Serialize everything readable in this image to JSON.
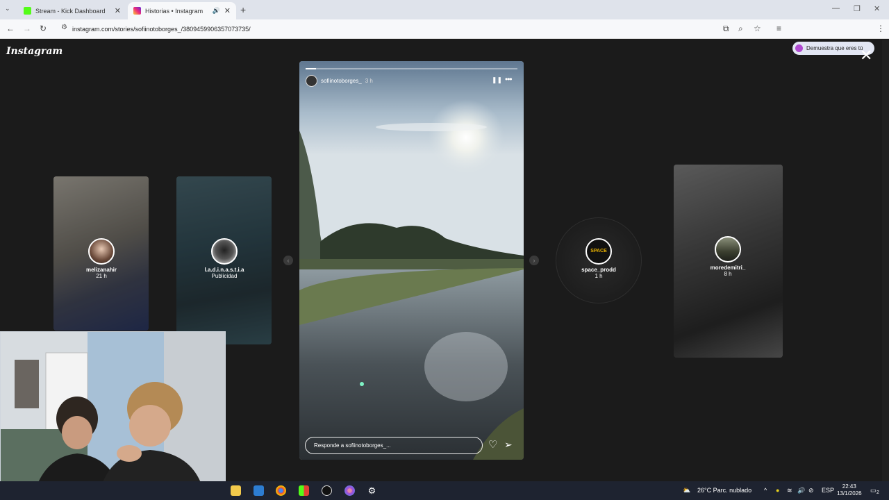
{
  "browser": {
    "tabs": [
      {
        "title": "Stream - Kick Dashboard",
        "active": false
      },
      {
        "title": "Historias • Instagram",
        "active": true
      }
    ],
    "url": "instagram.com/stories/sofiinotoborges_/3809459906357073735/",
    "profile_label": "Demuestra que eres tú"
  },
  "instagram": {
    "logo": "Instagram",
    "stories_prev": [
      {
        "username": "melizanahir",
        "time": "21 h"
      },
      {
        "username": "l.a.d.i.n.a.s.t.i.a",
        "time": "Publicidad"
      }
    ],
    "current": {
      "username": "sofiinotoborges_",
      "time": "3 h",
      "reply_placeholder": "Responde a sofiinotoborges_...",
      "progress_fraction": 0.05
    },
    "stories_next": [
      {
        "username": "space_prodd",
        "time": "1 h",
        "logo_text": "SPACE"
      },
      {
        "username": "moredemitri_",
        "time": "8 h"
      }
    ]
  },
  "taskbar": {
    "weather": "26°C  Parc. nublado",
    "lang": "ESP",
    "time": "22:43",
    "date": "13/1/2026",
    "notif_count": "2"
  },
  "icons": [
    "close-icon",
    "pause-icon",
    "more-icon",
    "heart-icon",
    "send-icon",
    "chevron-left-icon",
    "chevron-right-icon"
  ]
}
